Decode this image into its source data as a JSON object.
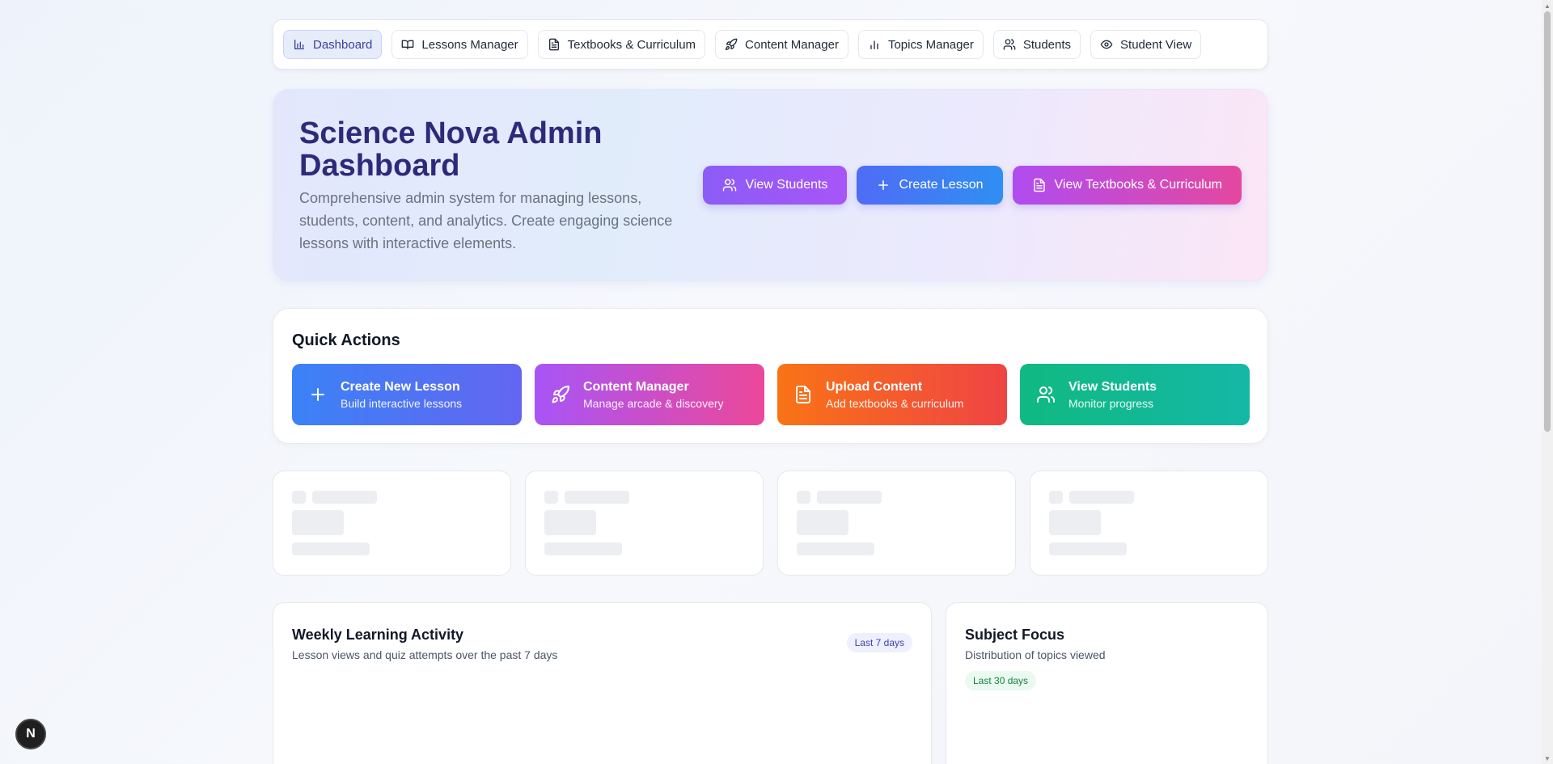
{
  "nav": {
    "items": [
      {
        "label": "Dashboard",
        "icon": "bar-chart-icon",
        "active": true
      },
      {
        "label": "Lessons Manager",
        "icon": "book-open-icon"
      },
      {
        "label": "Textbooks & Curriculum",
        "icon": "document-icon"
      },
      {
        "label": "Content Manager",
        "icon": "rocket-icon"
      },
      {
        "label": "Topics Manager",
        "icon": "bar-chart-icon"
      },
      {
        "label": "Students",
        "icon": "users-icon"
      },
      {
        "label": "Student View",
        "icon": "eye-icon"
      }
    ]
  },
  "hero": {
    "title": "Science Nova Admin Dashboard",
    "description": "Comprehensive admin system for managing lessons, students, content, and analytics. Create engaging science lessons with interactive elements.",
    "buttons": [
      {
        "label": "View Students",
        "icon": "users-icon"
      },
      {
        "label": "Create Lesson",
        "icon": "plus-icon"
      },
      {
        "label": "View Textbooks & Curriculum",
        "icon": "document-icon"
      }
    ]
  },
  "quick_actions": {
    "title": "Quick Actions",
    "cards": [
      {
        "title": "Create New Lesson",
        "subtitle": "Build interactive lessons",
        "icon": "plus-icon"
      },
      {
        "title": "Content Manager",
        "subtitle": "Manage arcade & discovery",
        "icon": "rocket-icon"
      },
      {
        "title": "Upload Content",
        "subtitle": "Add textbooks & curriculum",
        "icon": "document-icon"
      },
      {
        "title": "View Students",
        "subtitle": "Monitor progress",
        "icon": "users-icon"
      }
    ]
  },
  "weekly": {
    "title": "Weekly Learning Activity",
    "subtitle": "Lesson views and quiz attempts over the past 7 days",
    "badge": "Last 7 days"
  },
  "subject": {
    "title": "Subject Focus",
    "subtitle": "Distribution of topics viewed",
    "badge": "Last 30 days"
  },
  "floating_badge": "N",
  "colors": {
    "accent_indigo": "#3b3f9f",
    "hero_title": "#2e2a7a",
    "qa_blue": "#3b82f6",
    "qa_pink": "#ec4899",
    "qa_orange": "#f97316",
    "qa_green": "#10b981"
  }
}
